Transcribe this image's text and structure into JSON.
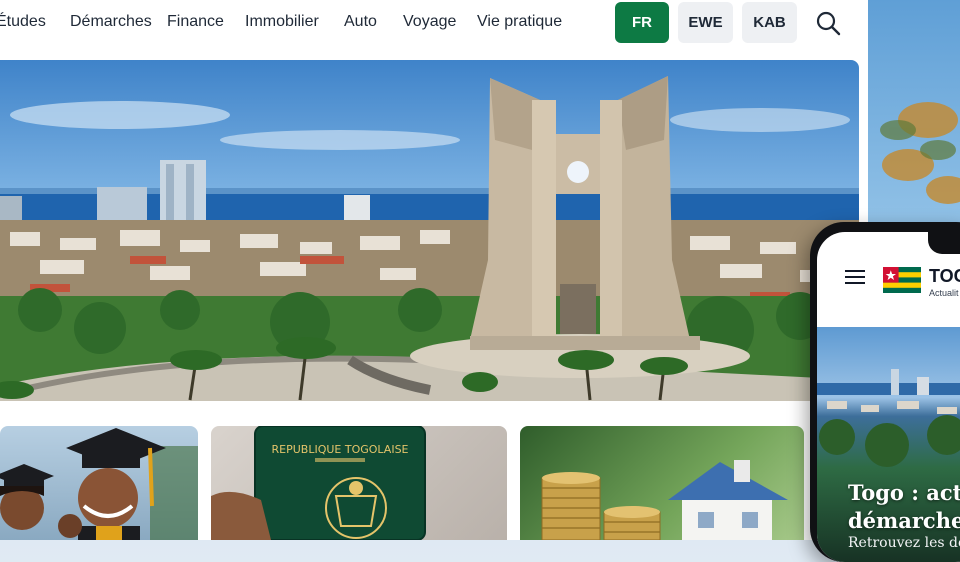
{
  "nav": {
    "items": [
      "Études",
      "Démarches",
      "Finance",
      "Immobilier",
      "Auto",
      "Voyage",
      "Vie pratique"
    ],
    "languages": [
      "FR",
      "EWE",
      "KAB"
    ],
    "active_language": "FR"
  },
  "cards": {
    "passport_text": "REPUBLIQUE TOGOLAISE"
  },
  "phone": {
    "brand": "TOG",
    "tagline": "Actualit",
    "hero_title_line1": "Togo : actu",
    "hero_title_line2": "démarches",
    "hero_subtitle": "Retrouvez les de"
  },
  "colors": {
    "accent": "#0d7a44",
    "lang_inactive": "#eef0f3",
    "text": "#1f2937"
  }
}
